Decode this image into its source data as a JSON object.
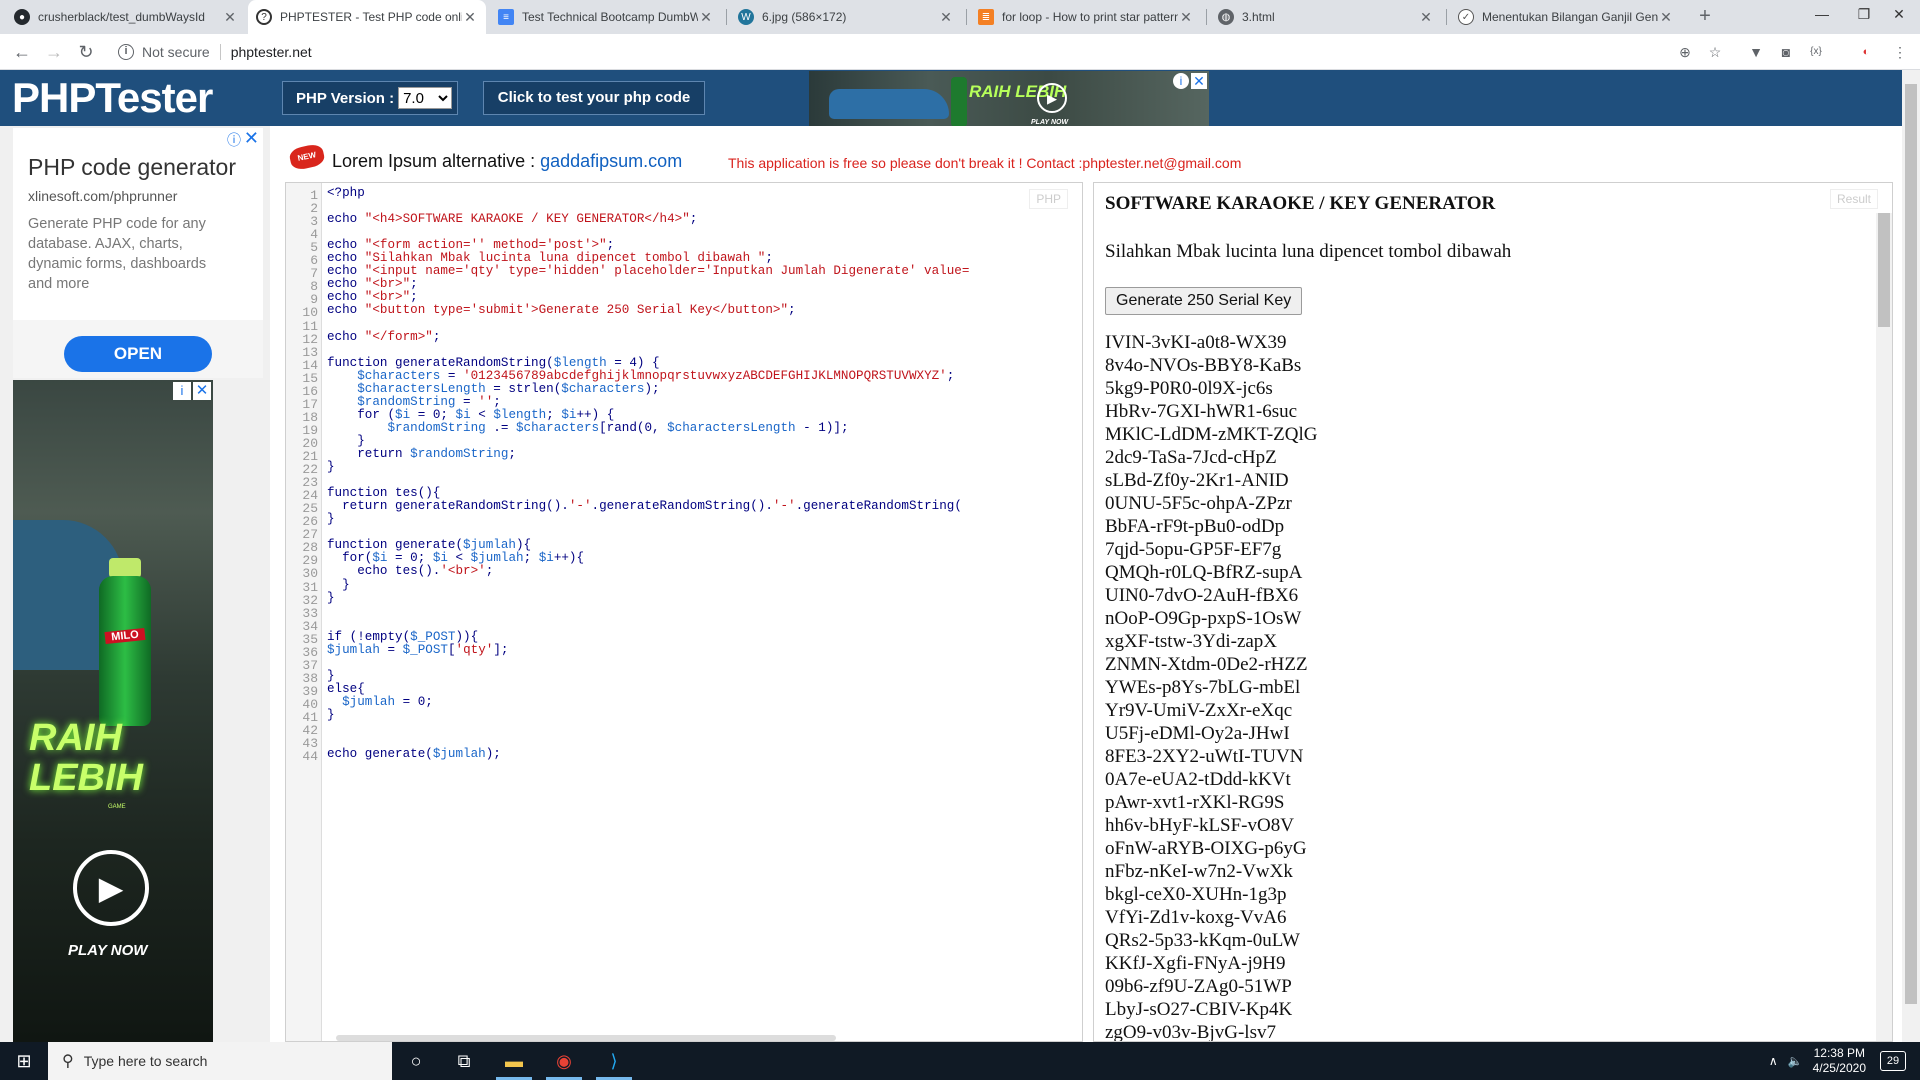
{
  "browser": {
    "tabs": [
      {
        "title": "crusherblack/test_dumbWaysId",
        "icon": "github-icon"
      },
      {
        "title": "PHPTESTER - Test PHP code online",
        "icon": "phptester-icon"
      },
      {
        "title": "Test Technical Bootcamp DumbWays",
        "icon": "docs-icon"
      },
      {
        "title": "6.jpg (586×172)",
        "icon": "wordpress-icon"
      },
      {
        "title": "for loop - How to print star pattern",
        "icon": "stackoverflow-icon"
      },
      {
        "title": "3.html",
        "icon": "globe-icon"
      },
      {
        "title": "Menentukan Bilangan Ganjil Genap",
        "icon": "site-icon"
      }
    ],
    "security_label": "Not secure",
    "url": "phptester.net"
  },
  "header": {
    "logo": "PHPTester",
    "php_version_label": "PHP Version :",
    "php_version_value": "7.0",
    "test_button": "Click to test your php code",
    "top_ad_text": "RAIH LEBIH",
    "top_ad_play": "PLAY NOW"
  },
  "ads": {
    "text_ad": {
      "title": "PHP code generator",
      "domain": "xlinesoft.com/phprunner",
      "description": "Generate PHP code for any database. AJAX, charts, dynamic forms, dashboards and more",
      "open_button": "OPEN"
    },
    "banner": {
      "brand": "MILO",
      "headline": "RAIH LEBIH",
      "subline": "GAME",
      "play": "PLAY NOW"
    }
  },
  "notice": {
    "lorem_label": "Lorem Ipsum alternative :",
    "lorem_link": "gaddafipsum.com",
    "message": "This application is free so please don't break it ! Contact :phptester.net@gmail.com",
    "badge": "NEW"
  },
  "editor": {
    "label": "PHP",
    "lines": [
      "<?php",
      "",
      "echo \"<h4>SOFTWARE KARAOKE / KEY GENERATOR</h4>\";",
      "",
      "echo \"<form action='' method='post'>\";",
      "echo \"Silahkan Mbak lucinta luna dipencet tombol dibawah \";",
      "echo \"<input name='qty' type='hidden' placeholder='Inputkan Jumlah Digenerate' value=",
      "echo \"<br>\";",
      "echo \"<br>\";",
      "echo \"<button type='submit'>Generate 250 Serial Key</button>\";",
      "",
      "echo \"</form>\";",
      "",
      "function generateRandomString($length = 4) {",
      "    $characters = '0123456789abcdefghijklmnopqrstuvwxyzABCDEFGHIJKLMNOPQRSTUVWXYZ';",
      "    $charactersLength = strlen($characters);",
      "    $randomString = '';",
      "    for ($i = 0; $i < $length; $i++) {",
      "        $randomString .= $characters[rand(0, $charactersLength - 1)];",
      "    }",
      "    return $randomString;",
      "}",
      "",
      "function tes(){",
      "  return generateRandomString().'-'.generateRandomString().'-'.generateRandomString(",
      "}",
      "",
      "function generate($jumlah){",
      "  for($i = 0; $i < $jumlah; $i++){",
      "    echo tes().'<br>';",
      "  }",
      "}",
      "",
      "",
      "if (!empty($_POST)){",
      "$jumlah = $_POST['qty'];",
      "",
      "}",
      "else{",
      "  $jumlah = 0;",
      "}",
      "",
      "",
      "echo generate($jumlah);"
    ]
  },
  "result": {
    "label": "Result",
    "heading": "SOFTWARE KARAOKE / KEY GENERATOR",
    "instruction": "Silahkan Mbak lucinta luna dipencet tombol dibawah",
    "button": "Generate 250 Serial Key",
    "keys": [
      "IVIN-3vKI-a0t8-WX39",
      "8v4o-NVOs-BBY8-KaBs",
      "5kg9-P0R0-0l9X-jc6s",
      "HbRv-7GXI-hWR1-6suc",
      "MKlC-LdDM-zMKT-ZQlG",
      "2dc9-TaSa-7Jcd-cHpZ",
      "sLBd-Zf0y-2Kr1-ANID",
      "0UNU-5F5c-ohpA-ZPzr",
      "BbFA-rF9t-pBu0-odDp",
      "7qjd-5opu-GP5F-EF7g",
      "QMQh-r0LQ-BfRZ-supA",
      "UIN0-7dvO-2AuH-fBX6",
      "nOoP-O9Gp-pxpS-1OsW",
      "xgXF-tstw-3Ydi-zapX",
      "ZNMN-Xtdm-0De2-rHZZ",
      "YWEs-p8Ys-7bLG-mbEl",
      "Yr9V-UmiV-ZxXr-eXqc",
      "U5Fj-eDMl-Oy2a-JHwI",
      "8FE3-2XY2-uWtI-TUVN",
      "0A7e-eUA2-tDdd-kKVt",
      "pAwr-xvt1-rXKl-RG9S",
      "hh6v-bHyF-kLSF-vO8V",
      "oFnW-aRYB-OIXG-p6yG",
      "nFbz-nKeI-w7n2-VwXk",
      "bkgl-ceX0-XUHn-1g3p",
      "VfYi-Zd1v-koxg-VvA6",
      "QRs2-5p33-kKqm-0uLW",
      "KKfJ-Xgfi-FNyA-j9H9",
      "09b6-zf9U-ZAg0-51WP",
      "LbyJ-sO27-CBIV-Kp4K",
      "zgO9-v03v-BjvG-lsv7"
    ]
  },
  "taskbar": {
    "search_placeholder": "Type here to search",
    "time": "12:38 PM",
    "date": "4/25/2020",
    "notifications": "29"
  }
}
